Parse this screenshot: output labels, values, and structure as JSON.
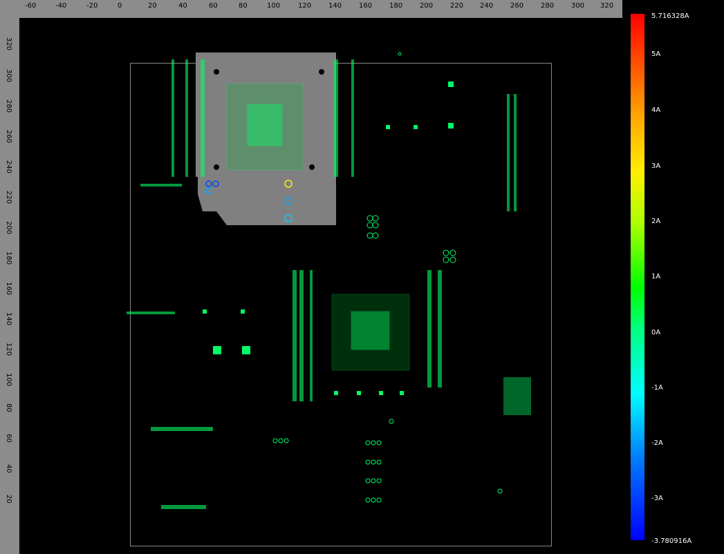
{
  "ruler_top_labels": [
    "-60",
    "-40",
    "-20",
    "0",
    "20",
    "40",
    "60",
    "80",
    "100",
    "120",
    "140",
    "160",
    "180",
    "200",
    "220",
    "240",
    "260",
    "280",
    "300",
    "320"
  ],
  "ruler_left_labels": [
    "320",
    "300",
    "280",
    "260",
    "240",
    "220",
    "200",
    "180",
    "160",
    "140",
    "120",
    "100",
    "80",
    "60",
    "40",
    "20"
  ],
  "colorbar": {
    "max_label": "5.716328A",
    "min_label": "-3.780916A",
    "tick_labels": [
      "5A",
      "4A",
      "3A",
      "2A",
      "1A",
      "0A",
      "-1A",
      "-2A",
      "-3A"
    ],
    "colors": [
      "#ff0000",
      "#ffaa00",
      "#ffee00",
      "#00ff00",
      "#00ffff",
      "#0000ff"
    ]
  },
  "colors": {
    "background": "#000000",
    "ruler": "#8c8c8c",
    "component_fill": "#808080",
    "trace": "#00ff66",
    "pad_low": "#00aaff"
  }
}
